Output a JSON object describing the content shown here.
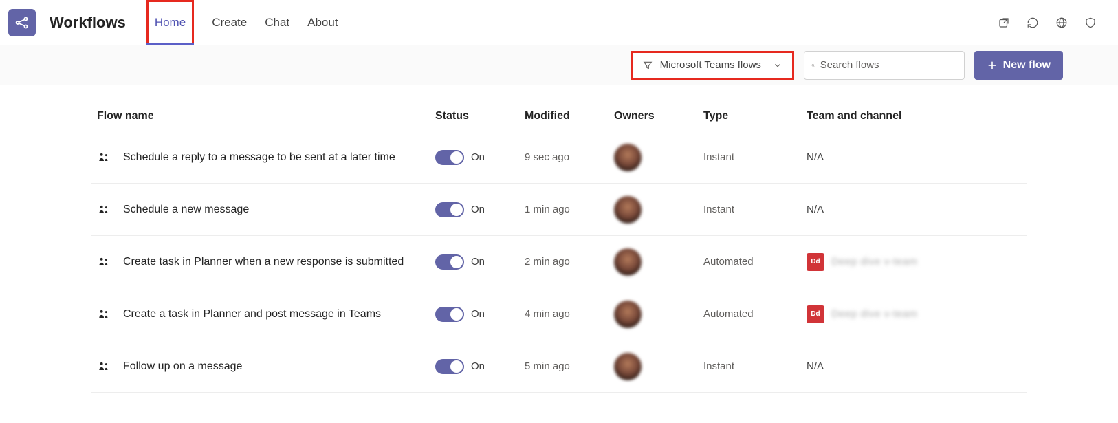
{
  "header": {
    "app_title": "Workflows",
    "tabs": [
      "Home",
      "Create",
      "Chat",
      "About"
    ],
    "active_tab_index": 0
  },
  "toolbar": {
    "filter_label": "Microsoft Teams flows",
    "search_placeholder": "Search flows",
    "new_flow_label": "New flow"
  },
  "table": {
    "columns": [
      "Flow name",
      "Status",
      "Modified",
      "Owners",
      "Type",
      "Team and channel"
    ],
    "rows": [
      {
        "name": "Schedule a reply to a message to be sent at a later time",
        "status": "On",
        "modified": "9 sec ago",
        "type": "Instant",
        "team": "N/A",
        "team_badge": ""
      },
      {
        "name": "Schedule a new message",
        "status": "On",
        "modified": "1 min ago",
        "type": "Instant",
        "team": "N/A",
        "team_badge": ""
      },
      {
        "name": "Create task in Planner when a new response is submitted",
        "status": "On",
        "modified": "2 min ago",
        "type": "Automated",
        "team": "Deep dive v-team",
        "team_badge": "Dd"
      },
      {
        "name": "Create a task in Planner and post message in Teams",
        "status": "On",
        "modified": "4 min ago",
        "type": "Automated",
        "team": "Deep dive v-team",
        "team_badge": "Dd"
      },
      {
        "name": "Follow up on a message",
        "status": "On",
        "modified": "5 min ago",
        "type": "Instant",
        "team": "N/A",
        "team_badge": ""
      }
    ]
  }
}
